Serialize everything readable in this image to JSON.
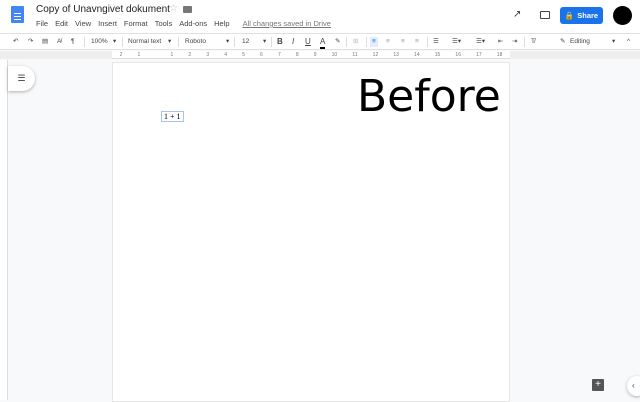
{
  "header": {
    "title": "Copy of Unavngivet dokument",
    "saved_status": "All changes saved in Drive",
    "share_label": "Share",
    "menus": [
      "File",
      "Edit",
      "View",
      "Insert",
      "Format",
      "Tools",
      "Add-ons",
      "Help"
    ]
  },
  "toolbar": {
    "zoom": "100%",
    "style": "Normal text",
    "font": "Roboto",
    "size": "12",
    "bold": "B",
    "italic": "I",
    "underline": "U",
    "text_color": "A",
    "mode": "Editing"
  },
  "ruler": {
    "ticks": [
      "2",
      "1",
      "",
      "1",
      "2",
      "3",
      "4",
      "5",
      "6",
      "7",
      "8",
      "9",
      "10",
      "11",
      "12",
      "13",
      "14",
      "15",
      "16",
      "17",
      "18"
    ]
  },
  "document": {
    "heading": "Before",
    "equation": "1 + 1"
  }
}
